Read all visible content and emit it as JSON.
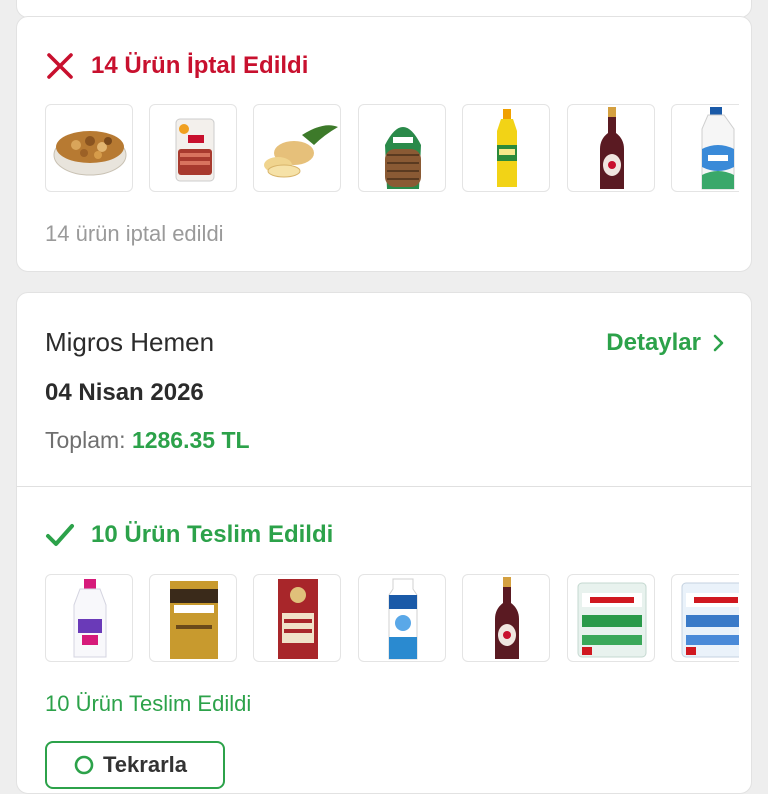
{
  "cancelled_section": {
    "title": "14 Ürün İptal Edildi",
    "summary": "14 ürün iptal edildi",
    "status_color": "#c8102e",
    "products": [
      {
        "icon": "mixed-nuts-icon"
      },
      {
        "icon": "sliced-meat-pack-icon"
      },
      {
        "icon": "ginger-root-icon"
      },
      {
        "icon": "bread-loaf-icon"
      },
      {
        "icon": "yellow-bottle-icon"
      },
      {
        "icon": "dark-syrup-bottle-icon"
      },
      {
        "icon": "milk-jug-icon"
      }
    ]
  },
  "order": {
    "store": "Migros Hemen",
    "details_label": "Detaylar",
    "date": "04 Nisan 2026",
    "total_label": "Toplam:",
    "total_value": "1286.35 TL"
  },
  "delivered_section": {
    "title": "10 Ürün Teslim Edildi",
    "summary": "10 Ürün Teslim Edildi",
    "status_color": "#2ca24a",
    "products": [
      {
        "icon": "detergent-bottle-icon"
      },
      {
        "icon": "coffee-package-icon"
      },
      {
        "icon": "filter-coffee-package-icon"
      },
      {
        "icon": "milk-carton-icon"
      },
      {
        "icon": "dark-syrup-bottle-icon"
      },
      {
        "icon": "water-pack-icon"
      },
      {
        "icon": "water-pack-icon"
      }
    ]
  },
  "repeat_button": {
    "label": "Tekrarla"
  }
}
